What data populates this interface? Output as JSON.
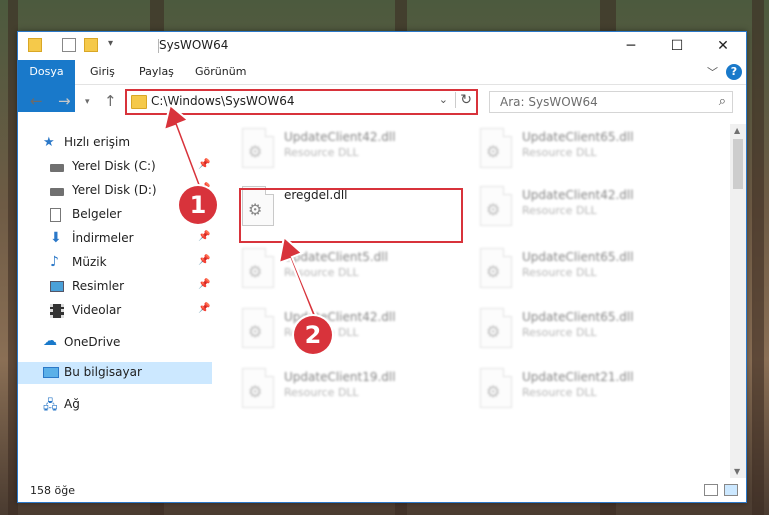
{
  "window": {
    "title": "SysWOW64",
    "controls": {
      "minimize": "─",
      "maximize": "☐",
      "close": "✕"
    }
  },
  "ribbon": {
    "tabs": [
      "Dosya",
      "Giriş",
      "Paylaş",
      "Görünüm"
    ],
    "help": "?"
  },
  "address_bar": {
    "path": "C:\\Windows\\SysWOW64",
    "search_placeholder": "Ara: SysWOW64"
  },
  "nav_pane": {
    "items": [
      {
        "label": "Hızlı erişim",
        "icon": "star-icon",
        "pinned": false
      },
      {
        "label": "Yerel Disk (C:)",
        "icon": "drive-icon",
        "pinned": true
      },
      {
        "label": "Yerel Disk (D:)",
        "icon": "drive-icon",
        "pinned": true
      },
      {
        "label": "Belgeler",
        "icon": "documents-icon",
        "pinned": true
      },
      {
        "label": "İndirmeler",
        "icon": "download-icon",
        "pinned": true
      },
      {
        "label": "Müzik",
        "icon": "music-icon",
        "pinned": true
      },
      {
        "label": "Resimler",
        "icon": "pictures-icon",
        "pinned": true
      },
      {
        "label": "Videolar",
        "icon": "video-icon",
        "pinned": true
      },
      {
        "label": "OneDrive",
        "icon": "cloud-icon",
        "pinned": false
      },
      {
        "label": "Bu bilgisayar",
        "icon": "computer-icon",
        "pinned": false,
        "selected": true
      },
      {
        "label": "Ağ",
        "icon": "network-icon",
        "pinned": false
      }
    ]
  },
  "files": {
    "type_label": "Resource DLL",
    "left_column": [
      "UpdateClient42.dll",
      "eregdel.dll",
      "UpdateClient5.dll",
      "UpdateClient42.dll",
      "UpdateClient19.dll"
    ],
    "right_column": [
      "UpdateClient65.dll",
      "UpdateClient42.dll",
      "UpdateClient65.dll",
      "UpdateClient65.dll",
      "UpdateClient21.dll"
    ]
  },
  "status": {
    "item_count": "158 öğe"
  },
  "annotations": {
    "callout_1": "1",
    "callout_2": "2"
  },
  "colors": {
    "accent": "#1979ca",
    "highlight": "#d8333b",
    "selection": "#cce8ff"
  }
}
